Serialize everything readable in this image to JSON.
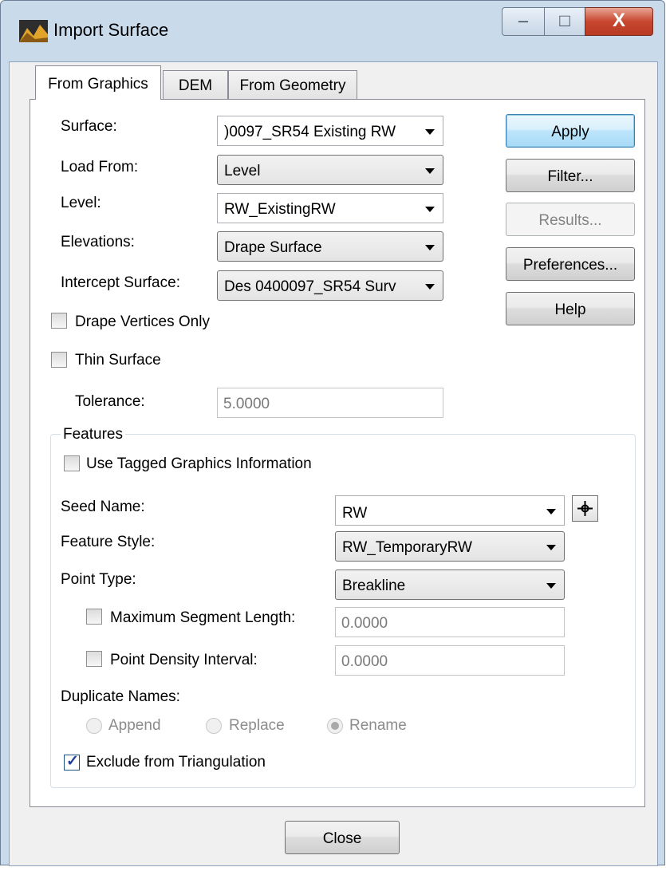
{
  "window": {
    "title": "Import Surface",
    "controls": {
      "minimize": "–",
      "maximize": "□",
      "close": "X"
    }
  },
  "tabs": [
    {
      "label": "From Graphics",
      "active": true
    },
    {
      "label": "DEM",
      "active": false
    },
    {
      "label": "From Geometry",
      "active": false
    }
  ],
  "form": {
    "surface": {
      "label": "Surface:",
      "value": ")0097_SR54 Existing RW"
    },
    "load_from": {
      "label": "Load From:",
      "value": "Level"
    },
    "level": {
      "label": "Level:",
      "value": "RW_ExistingRW"
    },
    "elevations": {
      "label": "Elevations:",
      "value": "Drape Surface"
    },
    "intercept_surface": {
      "label": "Intercept Surface:",
      "value": "Des 0400097_SR54 Surv"
    },
    "drape_vertices_only": {
      "label": "Drape Vertices Only",
      "checked": false
    },
    "thin_surface": {
      "label": "Thin Surface",
      "checked": false
    },
    "tolerance": {
      "label": "Tolerance:",
      "value": "5.0000"
    }
  },
  "buttons": {
    "apply": "Apply",
    "filter": "Filter...",
    "results": "Results...",
    "preferences": "Preferences...",
    "help": "Help",
    "close": "Close"
  },
  "features": {
    "group_label": "Features",
    "use_tagged": {
      "label": "Use Tagged Graphics Information",
      "checked": false
    },
    "seed_name": {
      "label": "Seed Name:",
      "value": "RW"
    },
    "feature_style": {
      "label": "Feature Style:",
      "value": "RW_TemporaryRW"
    },
    "point_type": {
      "label": "Point Type:",
      "value": "Breakline"
    },
    "max_segment_length": {
      "label": "Maximum Segment Length:",
      "value": "0.0000",
      "checked": false
    },
    "point_density_interval": {
      "label": "Point Density Interval:",
      "value": "0.0000",
      "checked": false
    },
    "duplicate_names": {
      "label": "Duplicate Names:",
      "options": [
        "Append",
        "Replace",
        "Rename"
      ],
      "selected": "Rename"
    },
    "exclude_from_triangulation": {
      "label": "Exclude from Triangulation",
      "checked": true
    }
  },
  "colors": {
    "window_frame": "#c9daea",
    "close_button": "#c8472e",
    "default_button": "#bee6fd",
    "panel": "#ffffff"
  }
}
